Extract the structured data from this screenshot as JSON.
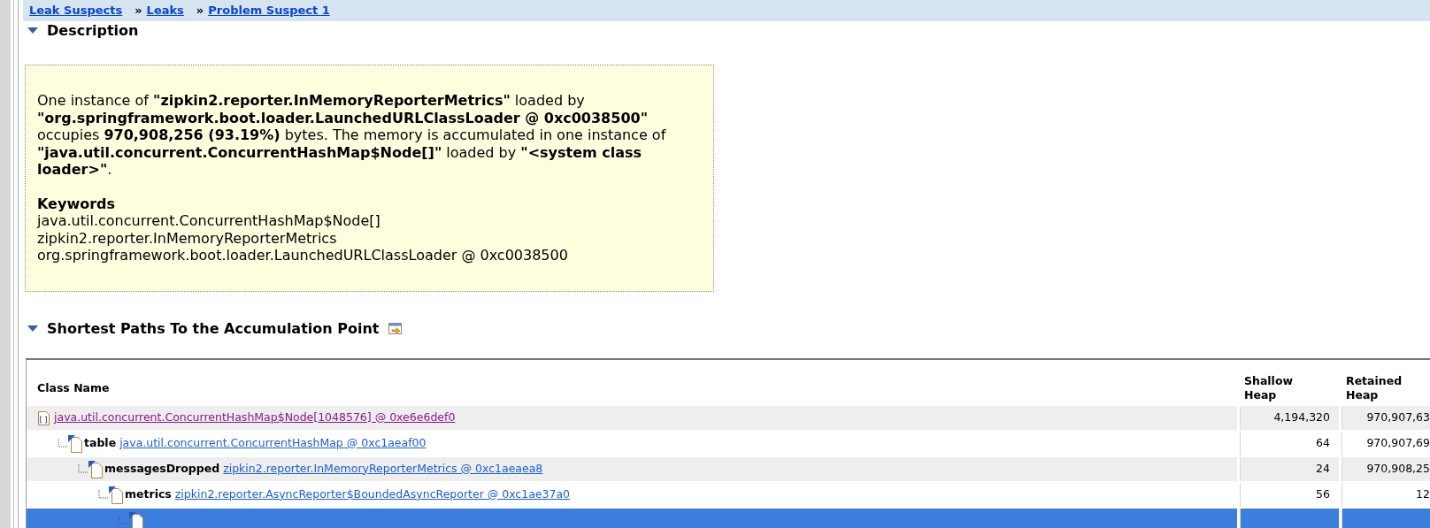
{
  "breadcrumb": [
    {
      "label": "Leak Suspects"
    },
    {
      "separator": "»",
      "label": "Leaks"
    },
    {
      "separator": "»",
      "label": "Problem Suspect 1"
    }
  ],
  "description": {
    "title": "Description",
    "expanded": true,
    "text": "One instance of **\"zipkin2.reporter.InMemoryReporterMetrics\"** loaded by **\"org.springframework.boot.loader.LaunchedURLClassLoader @ 0xc0038500\"** occupies **970,908,256 (93.19%)** bytes. The memory is accumulated in one instance of **\"java.util.concurrent.ConcurrentHashMap$Node[]\"** loaded by **\"<system class loader>\"**.",
    "keywords_title": "Keywords",
    "keywords": [
      "java.util.concurrent.ConcurrentHashMap$Node[]",
      "zipkin2.reporter.InMemoryReporterMetrics",
      "org.springframework.boot.loader.LaunchedURLClassLoader @ 0xc0038500"
    ]
  },
  "paths": {
    "title": "Shortest Paths To the Accumulation Point",
    "expanded": true,
    "table": {
      "columns": [
        "Class Name",
        "Shallow Heap",
        "Retained Heap"
      ],
      "rows": [
        {
          "kind": "array",
          "link": "java.util.concurrent.ConcurrentHashMap$Node[1048576] @ 0xe6e6def0",
          "visited": true,
          "shallow_heap": "4,194,320",
          "retained_heap": "970,907,63",
          "selected": false,
          "children": [
            {
              "kind": "object",
              "field": "table",
              "link": "java.util.concurrent.ConcurrentHashMap @ 0xc1aeaf00",
              "visited": false,
              "shallow_heap": "64",
              "retained_heap": "970,907,69",
              "selected": false,
              "children": [
                {
                  "kind": "object",
                  "field": "messagesDropped",
                  "link": "zipkin2.reporter.InMemoryReporterMetrics @ 0xc1aeaea8",
                  "visited": false,
                  "shallow_heap": "24",
                  "retained_heap": "970,908,25",
                  "selected": false,
                  "children": [
                    {
                      "kind": "object",
                      "field": "metrics",
                      "link": "zipkin2.reporter.AsyncReporter$BoundedAsyncReporter @ 0xc1ae37a0",
                      "visited": false,
                      "shallow_heap": "56",
                      "retained_heap": "12",
                      "selected": false,
                      "children": [
                        {
                          "kind": "object",
                          "selected": true
                        }
                      ]
                    }
                  ]
                }
              ]
            }
          ]
        }
      ]
    }
  }
}
